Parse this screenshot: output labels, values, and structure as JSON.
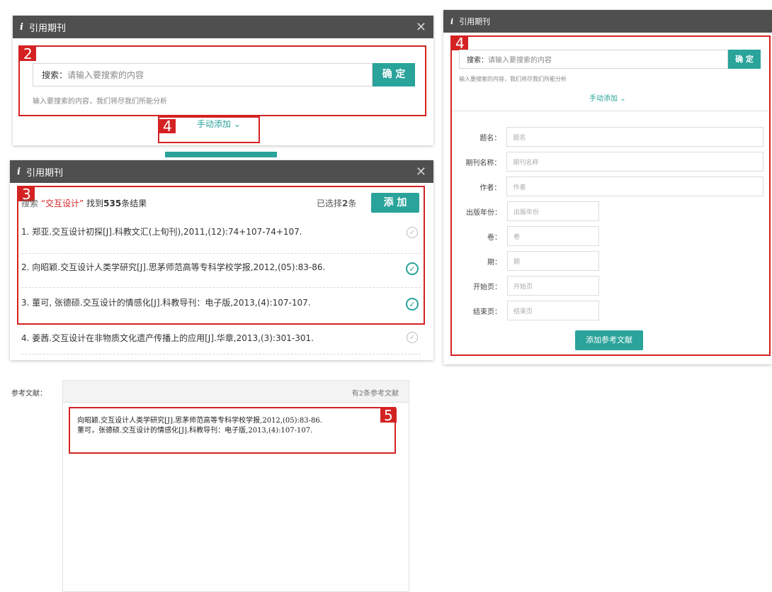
{
  "dialog1": {
    "title": "引用期刊",
    "search_label": "搜索：",
    "search_placeholder": "请输入要搜索的内容",
    "confirm": "确 定",
    "hint": "输入要搜索的内容，我们将尽我们所能分析",
    "manual_add": "手动添加",
    "tag_search": "2",
    "tag_manual": "4"
  },
  "dialog2": {
    "title": "引用期刊",
    "tag": "3",
    "result_prefix": "搜索",
    "result_keyword": "“交互设计”",
    "result_mid": "找到",
    "result_count": "535",
    "result_suffix": "条结果",
    "selected_prefix": "已选择",
    "selected_count": "2",
    "selected_suffix": "条",
    "add": "添 加",
    "items": [
      {
        "text": "1. 郑亚.交互设计初探[J].科教文汇(上旬刊),2011,(12):74+107-74+107.",
        "selected": false
      },
      {
        "text": "2. 向昭颖.交互设计人类学研究[J].思茅师范高等专科学校学报,2012,(05):83-86.",
        "selected": true
      },
      {
        "text": "3. 董可, 张德硕.交互设计的情感化[J].科教导刊：电子版,2013,(4):107-107.",
        "selected": true
      },
      {
        "text": "4. 姜茜.交互设计在非物质文化遗产传播上的应用[J].华章,2013,(3):301-301.",
        "selected": false
      }
    ]
  },
  "dialog3": {
    "title": "引用期刊",
    "tag": "4",
    "search_label": "搜索：",
    "search_placeholder": "请输入要搜索的内容",
    "confirm": "确 定",
    "hint": "输入要搜索的内容，我们将尽我们所能分析",
    "manual_add": "手动添加",
    "fields": [
      {
        "label": "题名：",
        "placeholder": "题名"
      },
      {
        "label": "期刊名称：",
        "placeholder": "期刊名称"
      },
      {
        "label": "作者：",
        "placeholder": "作者"
      },
      {
        "label": "出版年份：",
        "placeholder": "出版年份"
      },
      {
        "label": "卷：",
        "placeholder": "卷"
      },
      {
        "label": "期：",
        "placeholder": "期"
      },
      {
        "label": "开始页：",
        "placeholder": "开始页"
      },
      {
        "label": "结束页：",
        "placeholder": "结束页"
      }
    ],
    "submit": "添加参考文献"
  },
  "references": {
    "label": "参考文献：",
    "count_text": "有2条参考文献",
    "tag": "5",
    "lines": [
      "向昭颖.交互设计人类学研究[J].思茅师范高等专科学校学报,2012,(05):83-86.",
      "董可，张德硕.交互设计的情感化[J].科教导刊：电子版,2013,(4):107-107."
    ]
  },
  "colors": {
    "accent": "#2aa39a",
    "highlight": "#d42222",
    "titlebar": "#4f4f4f"
  }
}
